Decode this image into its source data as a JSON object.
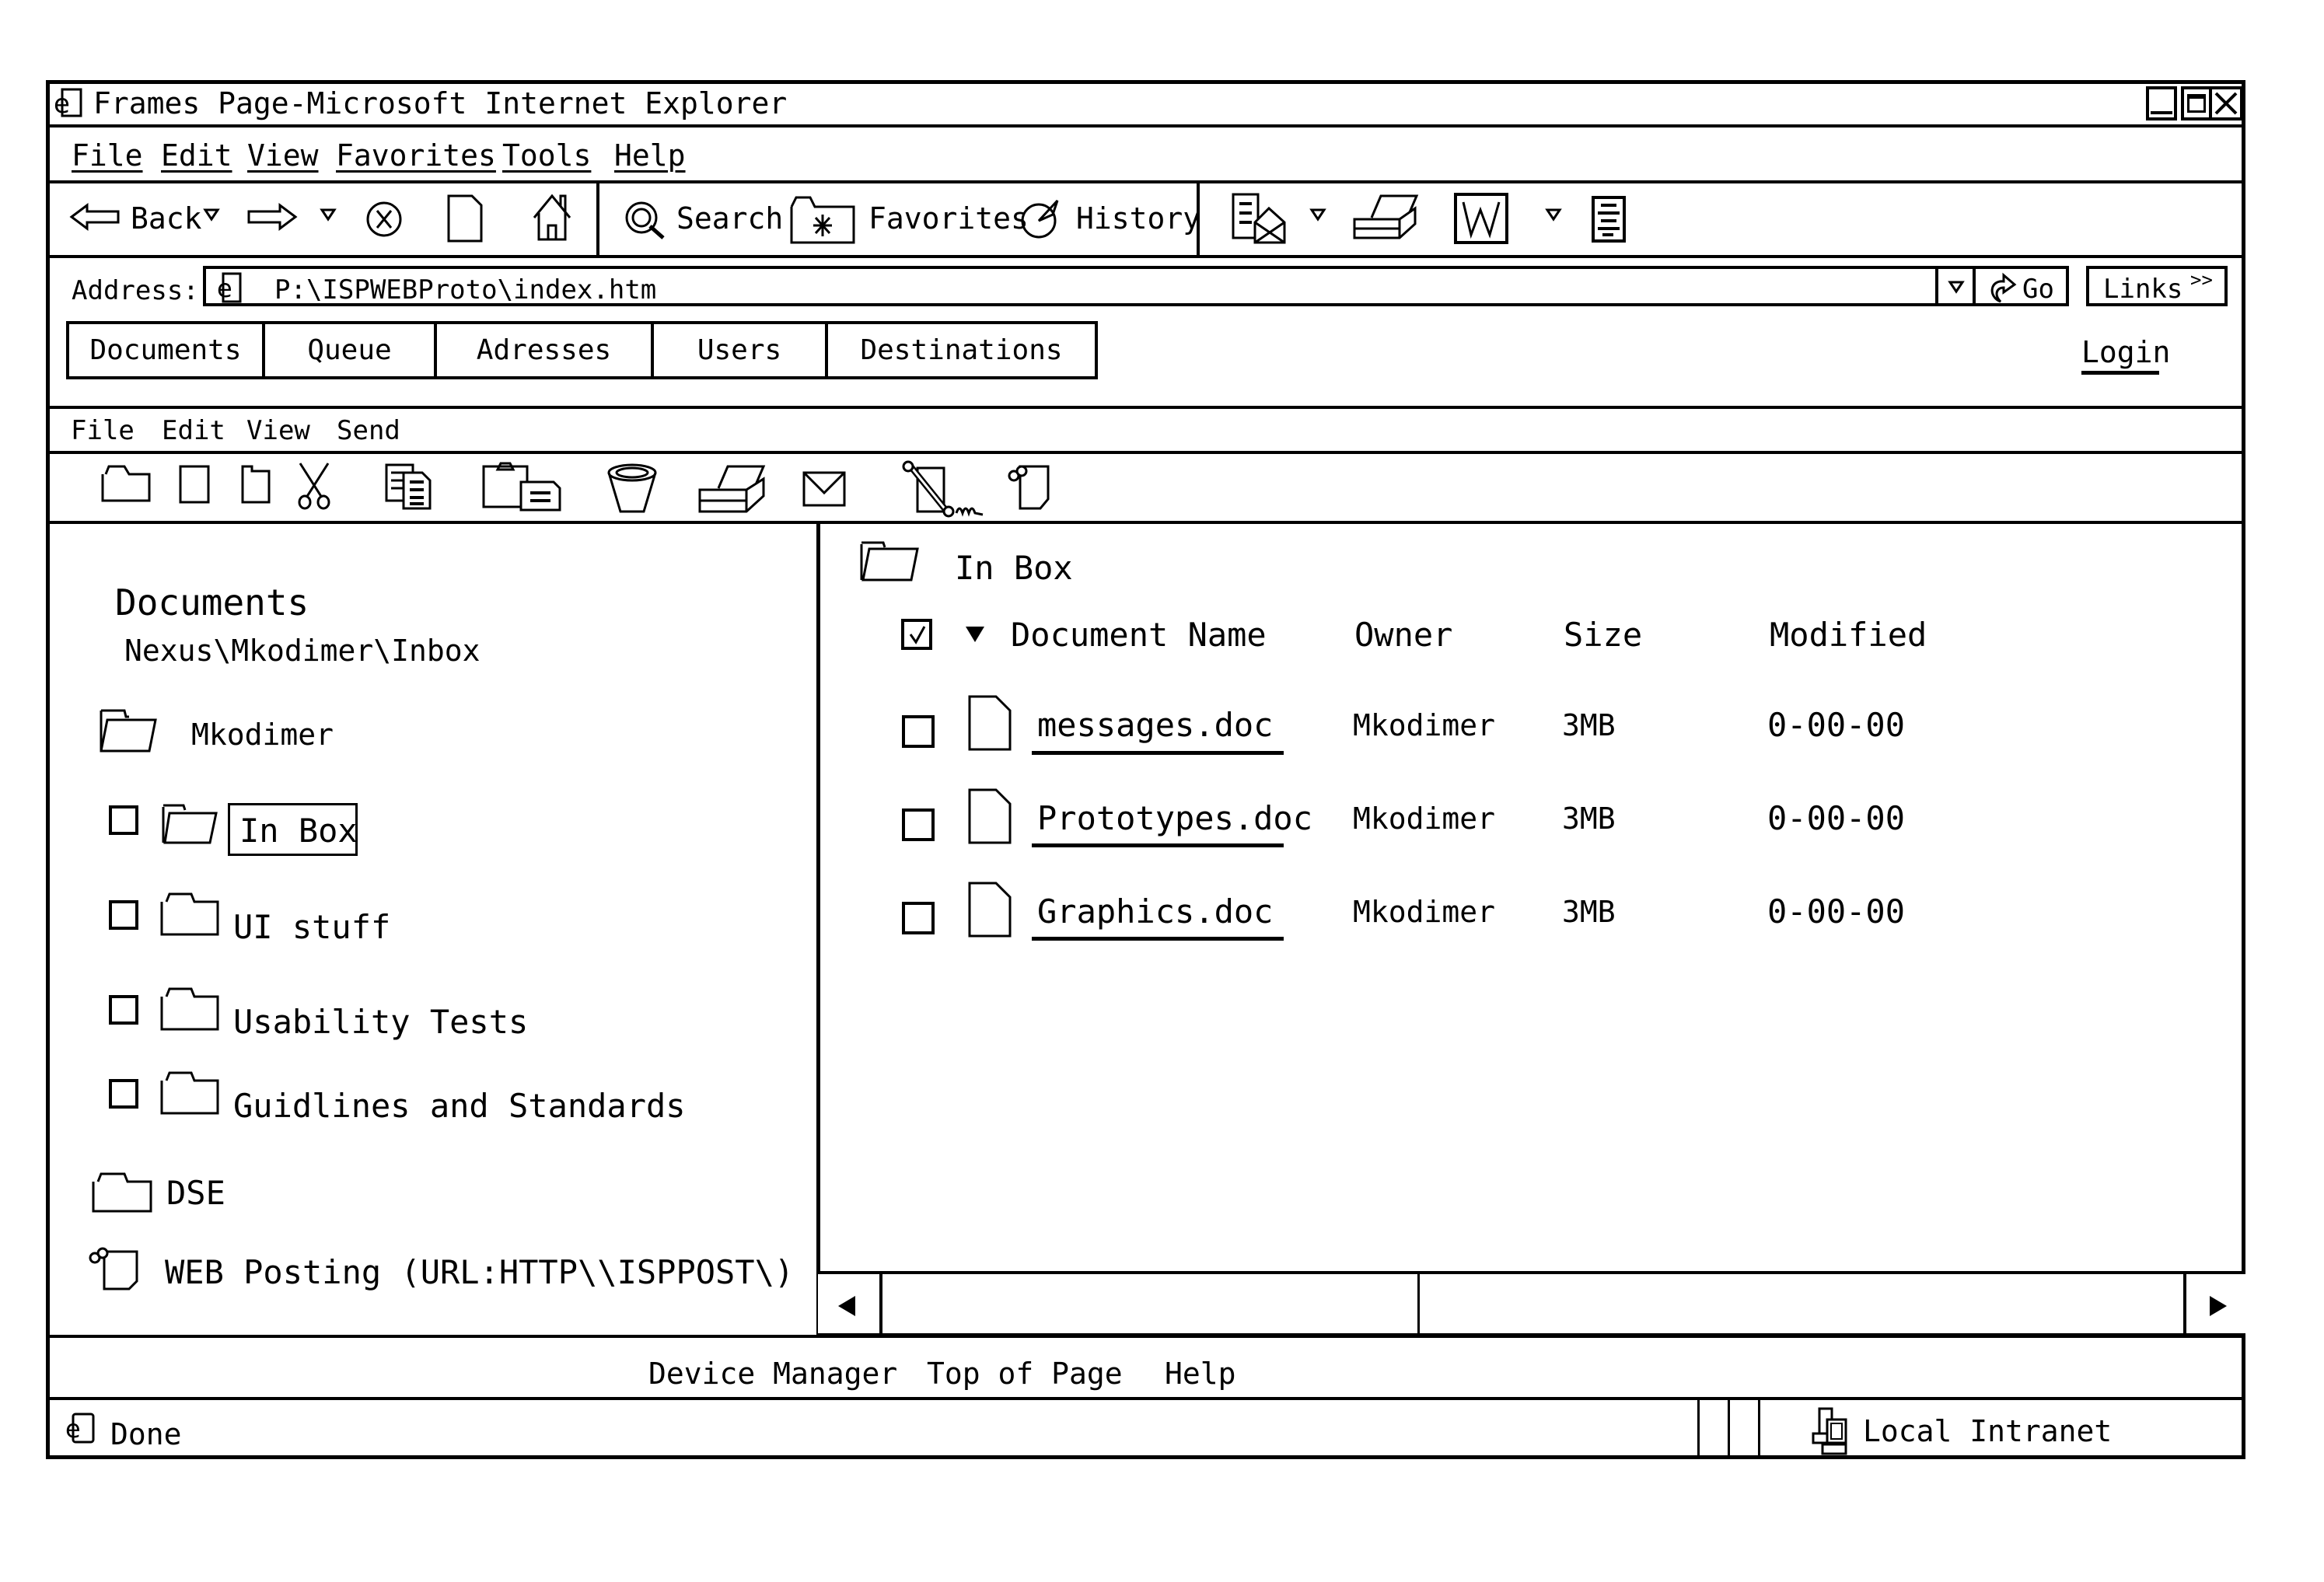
{
  "window": {
    "title": "Frames Page-Microsoft Internet Explorer",
    "controls": [
      "minimize-icon",
      "maximize-icon",
      "close-icon"
    ]
  },
  "menu_bar": {
    "items": [
      "File",
      "Edit",
      "View",
      "Favorites",
      "Tools",
      "Help"
    ]
  },
  "toolbar": {
    "back_label": "Back",
    "search_label": "Search",
    "favorites_label": "Favorites",
    "history_label": "History",
    "icons": [
      "back-arrow-icon",
      "forward-arrow-icon",
      "stop-icon",
      "refresh-page-icon",
      "home-icon",
      "search-icon",
      "favorites-icon",
      "history-icon",
      "mail-icon",
      "print-icon",
      "word-edit-icon",
      "discuss-icon"
    ]
  },
  "address_bar": {
    "label": "Address:",
    "value": "P:\\ISPWEBProto\\index.htm",
    "go_label": "Go",
    "links_label": "Links",
    "links_chevron": ">>"
  },
  "nav_tabs": {
    "items": [
      "Documents",
      "Queue",
      "Adresses",
      "Users",
      "Destinations"
    ],
    "login_label": "Login"
  },
  "inner_menu": {
    "items": [
      "File",
      "Edit",
      "View",
      "Send"
    ]
  },
  "inner_toolbar": {
    "icons": [
      "open-folder-icon",
      "blank-page-icon",
      "new-document-icon",
      "cut-scissors-icon",
      "copy-icon",
      "paste-clipboard-icon",
      "trash-bin-icon",
      "print-icon",
      "mail-envelope-icon",
      "fax-tool-icon",
      "web-post-icon"
    ]
  },
  "left_pane": {
    "heading": "Documents",
    "path": "Nexus\\Mkodimer\\Inbox",
    "root_folder": "Mkodimer",
    "folders": [
      {
        "label": "In Box",
        "selected": true,
        "checked": false
      },
      {
        "label": "UI stuff",
        "selected": false,
        "checked": false
      },
      {
        "label": "Usability Tests",
        "selected": false,
        "checked": false
      },
      {
        "label": "Guidlines and Standards",
        "selected": false,
        "checked": false
      }
    ],
    "dse_label": "DSE",
    "web_posting_label": "WEB Posting (URL:HTTP\\\\ISPPOST\\)"
  },
  "right_pane": {
    "folder_title": "In Box",
    "columns": {
      "select_all_checked": true,
      "name": "Document Name",
      "owner": "Owner",
      "size": "Size",
      "modified": "Modified"
    },
    "rows": [
      {
        "name": "messages.doc",
        "owner": "Mkodimer",
        "size": "3MB",
        "modified": "0-00-00",
        "checked": false
      },
      {
        "name": "Prototypes.doc",
        "owner": "Mkodimer",
        "size": "3MB",
        "modified": "0-00-00",
        "checked": false
      },
      {
        "name": "Graphics.doc",
        "owner": "Mkodimer",
        "size": "3MB",
        "modified": "0-00-00",
        "checked": false
      }
    ]
  },
  "footer_links": {
    "items": [
      "Device Manager",
      "Top of Page",
      "Help"
    ]
  },
  "status_bar": {
    "status": "Done",
    "zone": "Local Intranet"
  }
}
